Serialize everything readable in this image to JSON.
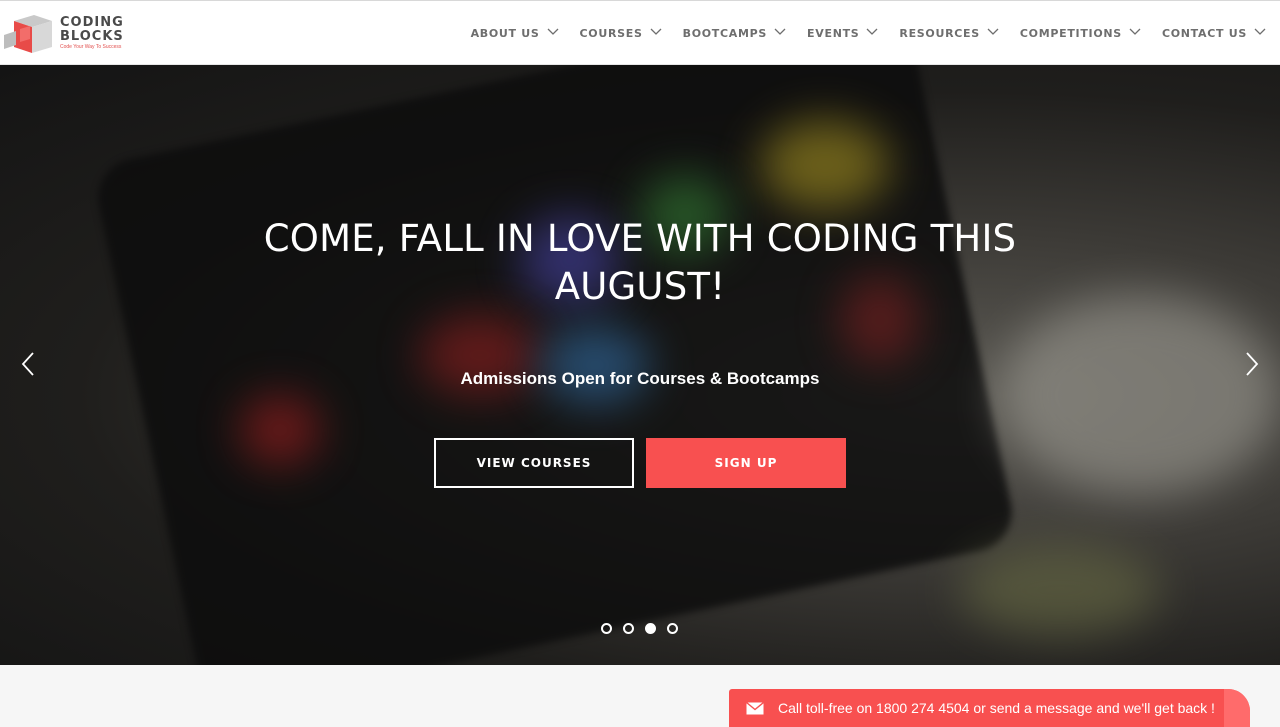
{
  "logo": {
    "line1": "CODING",
    "line2": "BLOCKS",
    "tagline": "Code Your Way To Success",
    "icon": "cube-logo-icon"
  },
  "nav": {
    "items": [
      {
        "label": "ABOUT US",
        "icon": "chevron-down-icon"
      },
      {
        "label": "COURSES",
        "icon": "chevron-down-icon"
      },
      {
        "label": "BOOTCAMPS",
        "icon": "chevron-down-icon"
      },
      {
        "label": "EVENTS",
        "icon": "chevron-down-icon"
      },
      {
        "label": "RESOURCES",
        "icon": "chevron-down-icon"
      },
      {
        "label": "COMPETITIONS",
        "icon": "chevron-down-icon"
      },
      {
        "label": "CONTACT US",
        "icon": "chevron-down-icon"
      }
    ]
  },
  "hero": {
    "title": "COME, FALL IN LOVE WITH CODING THIS AUGUST!",
    "subtitle": "Admissions Open for Courses & Bootcamps",
    "primary_button": "VIEW COURSES",
    "secondary_button": "SIGN UP",
    "prev_icon": "chevron-left-icon",
    "next_icon": "chevron-right-icon",
    "slide_count": 4,
    "active_slide": 3
  },
  "callbar": {
    "text": "Call toll-free on 1800 274 4504 or send a message and we'll get back !",
    "icon": "mail-icon"
  },
  "colors": {
    "accent": "#f85050",
    "nav_text": "#6e6e6e",
    "header_bg": "#ffffff"
  }
}
